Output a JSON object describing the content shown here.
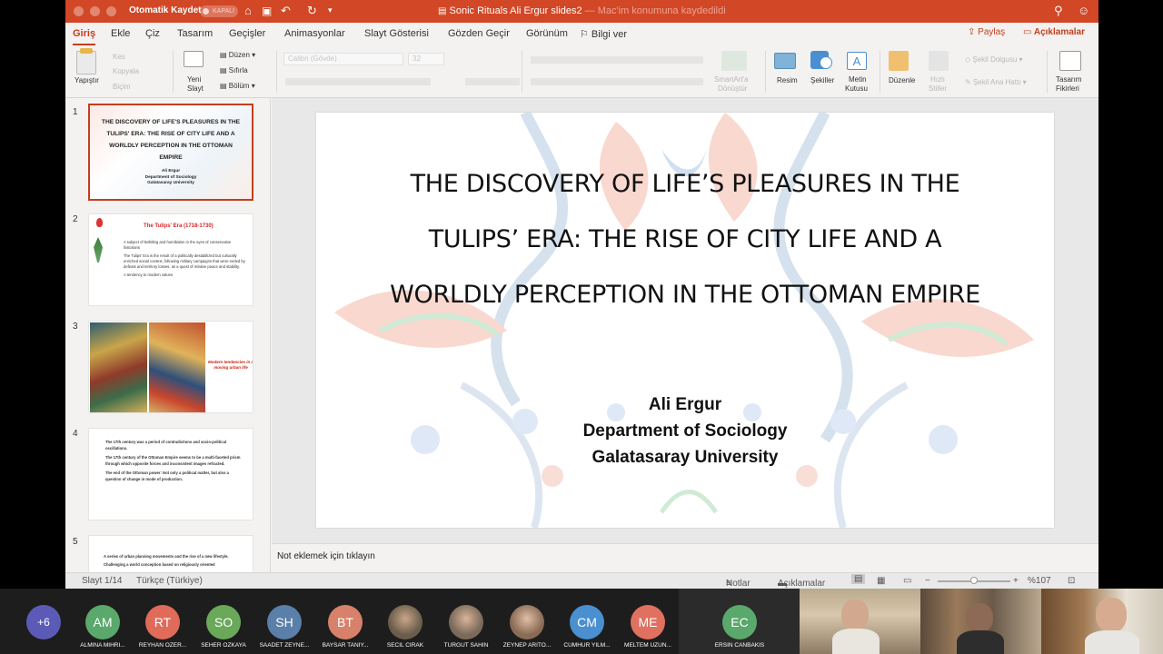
{
  "titlebar": {
    "autosave_label": "Otomatik Kaydet",
    "autosave_state": "KAPALI",
    "document_name": "Sonic Rituals Ali Ergur slides2",
    "save_location": "— Mac'im konumuna kaydedildi"
  },
  "tabs": [
    "Giriş",
    "Ekle",
    "Çiz",
    "Tasarım",
    "Geçişler",
    "Animasyonlar",
    "Slayt Gösterisi",
    "Gözden Geçir",
    "Görünüm",
    "Bilgi ver"
  ],
  "share_label": "Paylaş",
  "comments_label": "Açıklamalar",
  "ribbon": {
    "paste": "Yapıştır",
    "cut": "Kes",
    "copy": "Kopyala",
    "format": "Biçim",
    "new_slide_1": "Yeni",
    "new_slide_2": "Slayt",
    "layout": "Düzen",
    "reset": "Sıfırla",
    "section": "Bölüm",
    "font_name": "Calibri (Gövde)",
    "font_size": "32",
    "smartart_1": "SmartArt'a",
    "smartart_2": "Dönüştür",
    "picture": "Resim",
    "shapes": "Şekiller",
    "textbox_1": "Metin",
    "textbox_2": "Kutusu",
    "arrange": "Düzenle",
    "quick_styles_1": "Hızlı",
    "quick_styles_2": "Stiller",
    "shape_fill": "Şekil Dolgusu",
    "shape_outline": "Şekil Ana Hattı",
    "designer_1": "Tasarım",
    "designer_2": "Fikirleri"
  },
  "slides": [
    {
      "num": "1",
      "title": "THE DISCOVERY OF LIFE'S PLEASURES IN THE TULIPS' ERA: THE RISE OF CITY LIFE AND A WORLDLY PERCEPTION IN THE OTTOMAN EMPIRE",
      "author_lines": [
        "Ali Ergur",
        "Department of Sociology",
        "Galatasaray University"
      ]
    },
    {
      "num": "2",
      "title": "The Tulips' Era (1718-1730)",
      "bullets": [
        "A subject of belittling and humiliation in the eyes of conservative historians",
        "The Tulips' Era is the result of a politically destabilized but culturally enriched social context, following military campaigns that were ended by defeats and territory losses, as a quest of relative peace and stability.",
        "A tendency to modern values"
      ]
    },
    {
      "num": "3",
      "caption": "Modern tendencies in a moving urban life"
    },
    {
      "num": "4",
      "bullets": [
        "The 17th century was a period of contradictions and socio-political oscillations.",
        "The 17th century of the Ottoman Empire seems to be a multi-faceted prism through which opposite forces and inconsistent images refracted.",
        "The end of the Ottoman power: Not only a political matter, but also a question of change in mode of production."
      ]
    },
    {
      "num": "5",
      "bullets": [
        "A series of urban planning movements and the rise of a new lifestyle.",
        "Challenging a world conception based on religiously oriented"
      ]
    }
  ],
  "main_slide": {
    "title_lines": [
      "THE DISCOVERY OF LIFE’S PLEASURES IN THE",
      "TULIPS’ ERA: THE RISE OF CITY LIFE AND A",
      "WORLDLY PERCEPTION IN THE OTTOMAN EMPIRE"
    ],
    "author": "Ali Ergur",
    "department": "Department of Sociology",
    "university": "Galatasaray University"
  },
  "notes_placeholder": "Not eklemek için tıklayın",
  "statusbar": {
    "slide_count": "Slayt 1/14",
    "language": "Türkçe (Türkiye)",
    "notes": "Notlar",
    "comments": "Açıklamalar",
    "zoom": "%107"
  },
  "meeting": {
    "overflow": "+6",
    "participants": [
      {
        "initials": "AM",
        "name": "ALMINA MIHRI...",
        "color": "#5aa86b"
      },
      {
        "initials": "RT",
        "name": "REYHAN OZER...",
        "color": "#e06b5a"
      },
      {
        "initials": "SO",
        "name": "SEHER OZKAYA",
        "color": "#6aa85a"
      },
      {
        "initials": "SH",
        "name": "SAADET ZEYNE...",
        "color": "#5a7fa8"
      },
      {
        "initials": "BT",
        "name": "BAYSAR TANIY...",
        "color": "#d7816a"
      },
      {
        "initials": "",
        "name": "SECIL CIRAK",
        "color": "#6b5d4b"
      },
      {
        "initials": "",
        "name": "TURGUT SAHIN",
        "color": "#7a6a5a"
      },
      {
        "initials": "",
        "name": "ZEYNEP ARITO...",
        "color": "#8a6b55"
      },
      {
        "initials": "CM",
        "name": "CUMHUR YILM...",
        "color": "#4a8fd0"
      },
      {
        "initials": "ME",
        "name": "MELTEM UZUN...",
        "color": "#e07060"
      },
      {
        "initials": "EC",
        "name": "ERSIN CANBAKIS",
        "color": "#5aa86b"
      }
    ]
  }
}
